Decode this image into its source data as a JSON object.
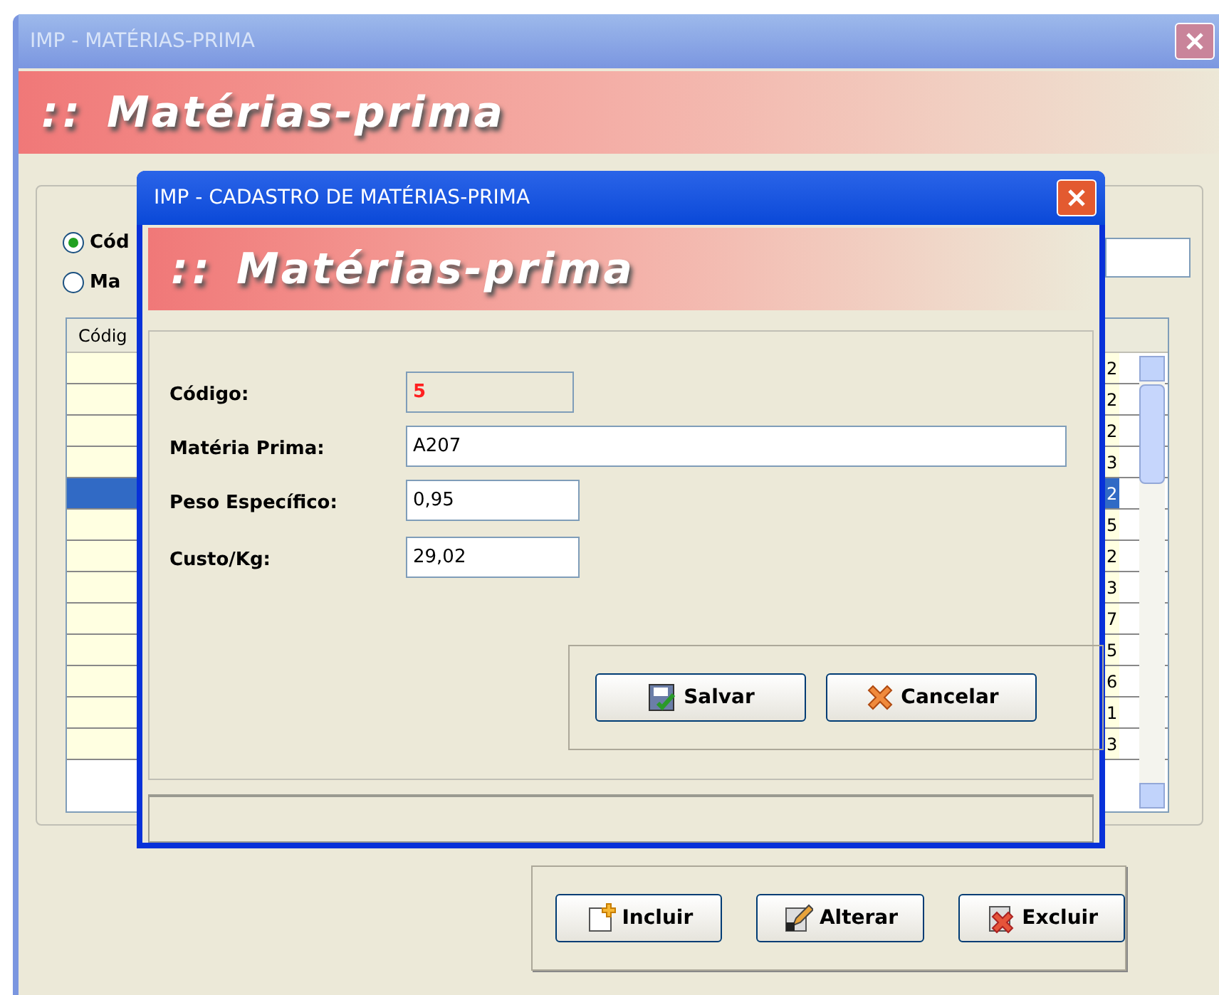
{
  "main_window": {
    "title": "IMP - MATÉRIAS-PRIMA",
    "banner": {
      "marker": "::",
      "title": "Matérias-prima"
    },
    "search_options": [
      {
        "label": "Cód",
        "selected": true
      },
      {
        "label": "Ma",
        "selected": false
      }
    ],
    "table": {
      "columns": [
        "Códig"
      ],
      "rows": [
        {
          "column_last": "2",
          "selected": false
        },
        {
          "column_last": "2",
          "selected": false
        },
        {
          "column_last": "2",
          "selected": false
        },
        {
          "column_last": "3",
          "selected": false
        },
        {
          "column_last": "2",
          "selected": true
        },
        {
          "column_last": "5",
          "selected": false
        },
        {
          "column_last": "2",
          "selected": false
        },
        {
          "column_last": "3",
          "selected": false
        },
        {
          "column_last": "7",
          "selected": false
        },
        {
          "column_last": "5",
          "selected": false
        },
        {
          "column_last": "6",
          "selected": false
        },
        {
          "column_last": "1",
          "selected": false
        },
        {
          "column_last": "3",
          "selected": false
        }
      ]
    },
    "buttons": [
      {
        "label": "Incluir",
        "kind": "add"
      },
      {
        "label": "Alterar",
        "kind": "edit"
      },
      {
        "label": "Excluir",
        "kind": "delete"
      }
    ]
  },
  "dialog": {
    "title": "IMP - CADASTRO DE MATÉRIAS-PRIMA",
    "banner": {
      "marker": "::",
      "title": "Matérias-prima"
    },
    "fields": [
      {
        "label": "Código:",
        "value": "5",
        "kind": "readonly"
      },
      {
        "label": "Matéria Prima:",
        "value": "A207",
        "kind": "wide"
      },
      {
        "label": "Peso Específico:",
        "value": "0,95",
        "kind": "short"
      },
      {
        "label": "Custo/Kg:",
        "value": "29,02",
        "kind": "short"
      }
    ],
    "buttons": [
      {
        "label": "Salvar",
        "kind": "save"
      },
      {
        "label": "Cancelar",
        "kind": "cancel"
      }
    ]
  }
}
